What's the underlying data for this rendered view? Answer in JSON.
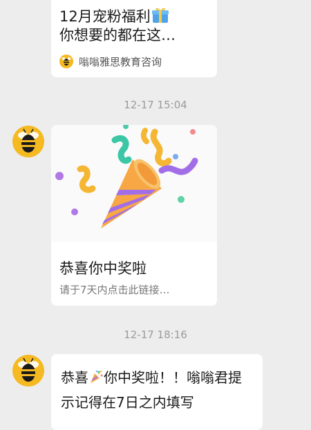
{
  "top_card": {
    "title_line1": "12月宠粉福利",
    "title_line2": "你想要的都在这…",
    "gift_icon": "gift-icon",
    "source_name": "嗡嗡雅思教育咨询"
  },
  "timestamps": [
    "12-17 15:04",
    "12-17 18:16"
  ],
  "prize_card": {
    "image_icon": "party-popper-illustration",
    "title": "恭喜你中奖啦",
    "description": "请于7天内点击此链接…"
  },
  "message_bubble": {
    "text_before_icon": "恭喜",
    "icon": "party-popper-icon",
    "text_after_icon": "你中奖啦！！嗡嗡君提示记得在7日之内填写"
  },
  "colors": {
    "background": "#ededed",
    "card": "#ffffff",
    "avatar_yellow": "#f5b922"
  }
}
